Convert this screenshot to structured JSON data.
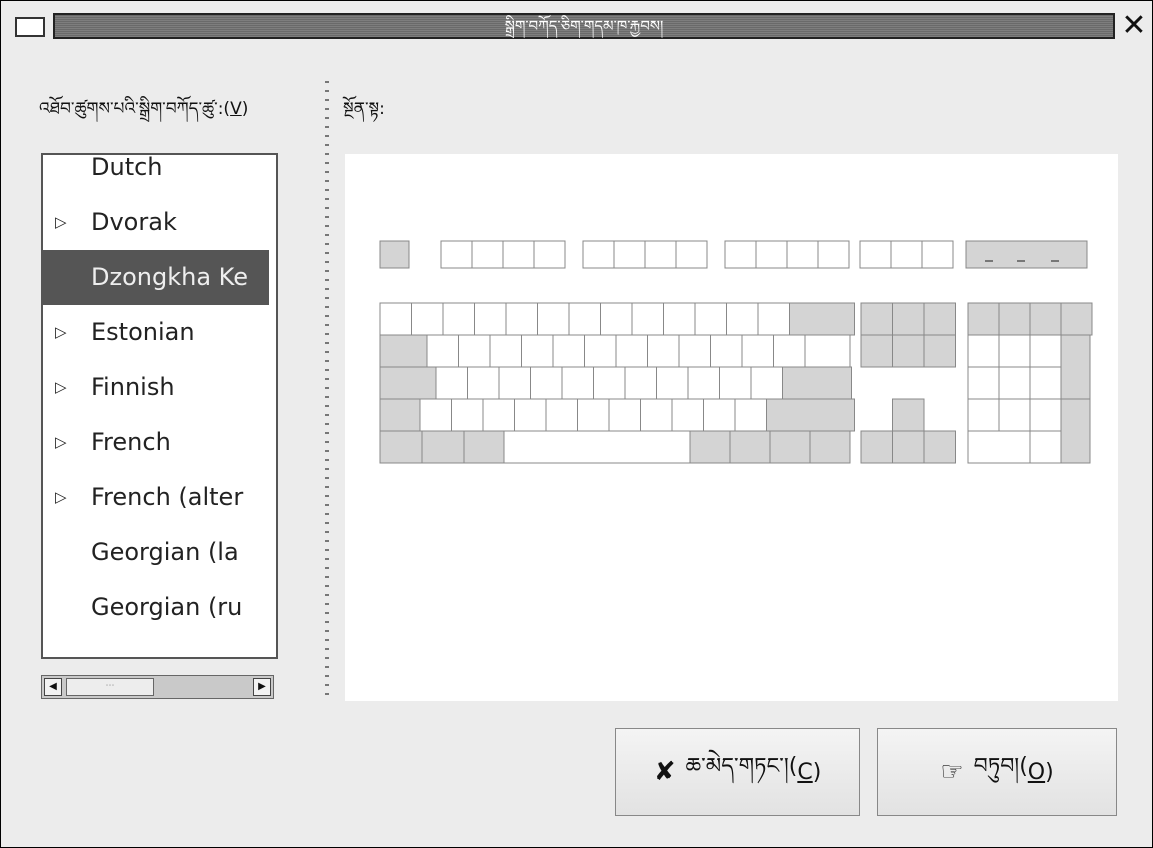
{
  "window": {
    "title": "སྒྲིག་བཀོད་ཅིག་གདམ་ཁ་རྐྱབས།",
    "close_glyph": "✕"
  },
  "left_panel": {
    "label_text": "འཐོབ་ཚུགས་པའི་སྒྲིག་བཀོད་ཚུ་:(",
    "label_mnemonic": "V",
    "label_tail": ")",
    "items": [
      {
        "label": "Dutch",
        "has_children": false,
        "selected": false
      },
      {
        "label": "Dvorak",
        "has_children": true,
        "selected": false
      },
      {
        "label": "Dzongkha Ke",
        "has_children": false,
        "selected": true
      },
      {
        "label": "Estonian",
        "has_children": true,
        "selected": false
      },
      {
        "label": "Finnish",
        "has_children": true,
        "selected": false
      },
      {
        "label": "French",
        "has_children": true,
        "selected": false
      },
      {
        "label": "French (alter",
        "has_children": true,
        "selected": false
      },
      {
        "label": "Georgian (la",
        "has_children": false,
        "selected": false
      },
      {
        "label": "Georgian (ru",
        "has_children": false,
        "selected": false
      }
    ],
    "expander_glyph": "▷",
    "vscroll_up": "▲",
    "vscroll_down": "▼",
    "vthumb_grip": "⋮",
    "hscroll_left": "◀",
    "hscroll_right": "▶",
    "hthumb_grip": "⋯"
  },
  "right_panel": {
    "label": "སྔོན་སྟ:"
  },
  "buttons": {
    "cancel": {
      "text": "ཆ་མེད་གཏང་།(",
      "mnemonic": "C",
      "tail": ")",
      "icon": "✘"
    },
    "ok": {
      "text": "བཏུབ།(",
      "mnemonic": "O",
      "tail": ")",
      "icon": "☞"
    }
  },
  "colors": {
    "key_white": "#ffffff",
    "key_gray": "#d4d4d4",
    "key_border": "#888888",
    "selection": "#555555"
  }
}
